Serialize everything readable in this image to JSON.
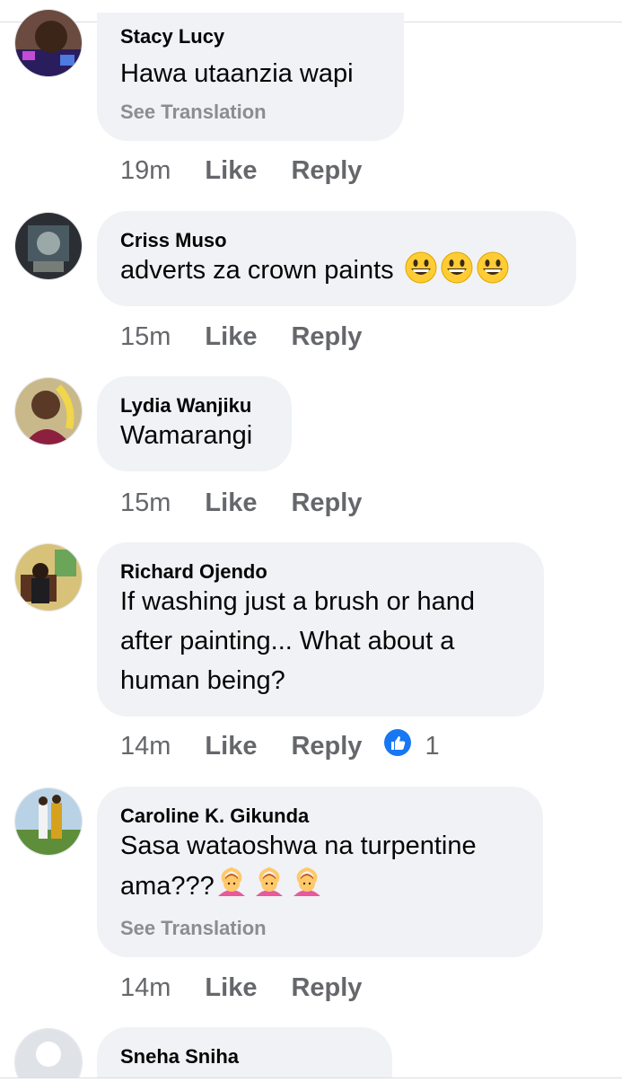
{
  "comments": [
    {
      "name": "Stacy Lucy",
      "lines": [
        "Hawa utaanzia wapi"
      ],
      "see_translation": "See Translation",
      "time": "19m",
      "like": "Like",
      "reply": "Reply"
    },
    {
      "name": "Criss Muso",
      "lines": [
        "adverts za crown paints"
      ],
      "emojis": [
        "grinning-face-emoji",
        "grinning-face-emoji",
        "grinning-face-emoji"
      ],
      "time": "15m",
      "like": "Like",
      "reply": "Reply"
    },
    {
      "name": "Lydia Wanjiku",
      "lines": [
        "Wamarangi"
      ],
      "time": "15m",
      "like": "Like",
      "reply": "Reply"
    },
    {
      "name": "Richard Ojendo",
      "lines": [
        "If washing just a brush or hand",
        "after painting... What about a",
        "human being?"
      ],
      "time": "14m",
      "like": "Like",
      "reply": "Reply",
      "reaction_icon": "thumbs-up-icon",
      "reaction_count": "1"
    },
    {
      "name": "Caroline K. Gikunda",
      "lines": [
        "Sasa wataoshwa na turpentine",
        "ama???"
      ],
      "emojis": [
        "person-gesturing-ok-emoji",
        "person-gesturing-ok-emoji",
        "person-gesturing-ok-emoji"
      ],
      "see_translation": "See Translation",
      "time": "14m",
      "like": "Like",
      "reply": "Reply"
    },
    {
      "name": "Sneha Sniha",
      "lines": []
    }
  ],
  "colors": {
    "bubble": "#f0f2f5",
    "meta_text": "#65676b",
    "translation_text": "#8a8d91",
    "like_blue": "#1877f2"
  }
}
